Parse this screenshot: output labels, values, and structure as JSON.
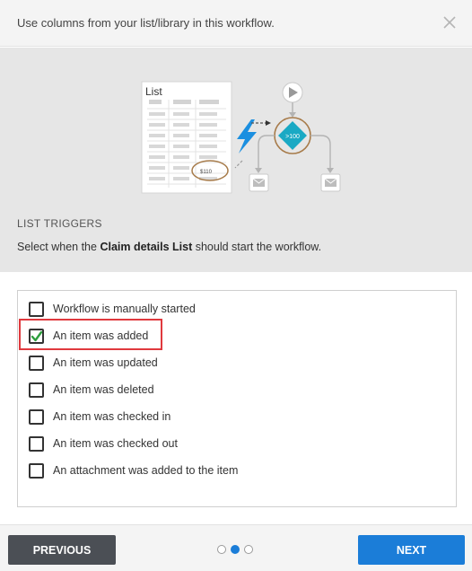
{
  "header": {
    "text": "Use columns from your list/library in this workflow.",
    "close_icon": "close-icon"
  },
  "illustration": {
    "list_title": "List",
    "amount_label": "$110",
    "condition_label": ">100",
    "icons": [
      "lightning-icon",
      "play-icon",
      "condition-diamond-icon",
      "email-icon"
    ],
    "accent_color": "#1aa9c4",
    "circle_color": "#a77b4a"
  },
  "section": {
    "title": "LIST TRIGGERS",
    "desc_prefix": "Select when the",
    "list_name": "Claim details List",
    "desc_suffix": "should start the workflow."
  },
  "triggers": [
    {
      "label": "Workflow is manually started",
      "checked": false
    },
    {
      "label": "An item was added",
      "checked": true
    },
    {
      "label": "An item was updated",
      "checked": false
    },
    {
      "label": "An item was deleted",
      "checked": false
    },
    {
      "label": "An item was checked in",
      "checked": false
    },
    {
      "label": "An item was checked out",
      "checked": false
    },
    {
      "label": "An attachment was added to the item",
      "checked": false
    }
  ],
  "footer": {
    "previous_label": "PREVIOUS",
    "next_label": "NEXT",
    "pages": 3,
    "current_page": 2
  },
  "colors": {
    "primary": "#1b7dd8",
    "secondary_button": "#4b4f55",
    "highlight": "#e0393e",
    "check": "#2e9e3e"
  }
}
